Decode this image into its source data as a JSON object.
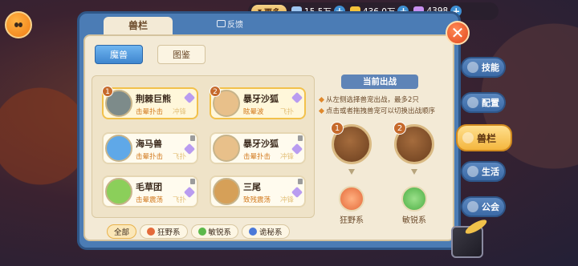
{
  "topbar": {
    "more_label": "更多",
    "resources": [
      {
        "icon": "shell-icon",
        "value": "15.5万",
        "color": "#9fc6f0"
      },
      {
        "icon": "gold-icon",
        "value": "436.0万",
        "color": "#f4c23a"
      },
      {
        "icon": "gem-icon",
        "value": "4398",
        "color": "#c890f0"
      }
    ]
  },
  "panel": {
    "title": "兽栏",
    "feedback": "反馈",
    "tabs": [
      "魔兽",
      "图鉴"
    ]
  },
  "pets": [
    {
      "name": "荆棘巨熊",
      "skill1": "击晕扑击",
      "skill2": "冲锋",
      "order": "1",
      "selected": true,
      "color": "#7d8b8a"
    },
    {
      "name": "暴牙沙狐",
      "skill1": "眩晕波",
      "skill2": "飞扑",
      "order": "2",
      "selected": true,
      "color": "#e8c08a"
    },
    {
      "name": "海马兽",
      "skill1": "击晕扑击",
      "skill2": "飞扑",
      "order": "",
      "selected": false,
      "color": "#5fa8e8"
    },
    {
      "name": "暴牙沙狐",
      "skill1": "击晕扑击",
      "skill2": "冲锋",
      "order": "",
      "selected": false,
      "color": "#e8c08a"
    },
    {
      "name": "毛草团",
      "skill1": "击晕震荡",
      "skill2": "飞扑",
      "order": "",
      "selected": false,
      "color": "#8bcf5a"
    },
    {
      "name": "三尾",
      "skill1": "致残震荡",
      "skill2": "冲锋",
      "order": "",
      "selected": false,
      "color": "#d6a058"
    }
  ],
  "filters": [
    {
      "label": "全部",
      "active": true,
      "icon": ""
    },
    {
      "label": "狂野系",
      "active": false,
      "icon": "fire-icon",
      "color": "#e46a3a"
    },
    {
      "label": "敏锐系",
      "active": false,
      "icon": "bolt-icon",
      "color": "#5cb84a"
    },
    {
      "label": "诡秘系",
      "active": false,
      "icon": "arcane-icon",
      "color": "#4a78d8"
    }
  ],
  "current": {
    "title": "当前出战",
    "hints": [
      "从左侧选择兽宠出战，最多2只",
      "点击或者拖拽兽宠可以切换出战顺序"
    ],
    "slots": [
      {
        "num": "1",
        "trait": "狂野系",
        "trait_color": "#e46a3a"
      },
      {
        "num": "2",
        "trait": "敏锐系",
        "trait_color": "#4cae44"
      }
    ]
  },
  "side_menu": [
    {
      "label": "技能",
      "icon": "skill-icon",
      "active": false
    },
    {
      "label": "配置",
      "icon": "gear-icon",
      "active": false
    },
    {
      "label": "兽栏",
      "icon": "gear-icon",
      "active": true
    },
    {
      "label": "生活",
      "icon": "home-icon",
      "active": false
    },
    {
      "label": "公会",
      "icon": "guild-icon",
      "active": false
    }
  ]
}
